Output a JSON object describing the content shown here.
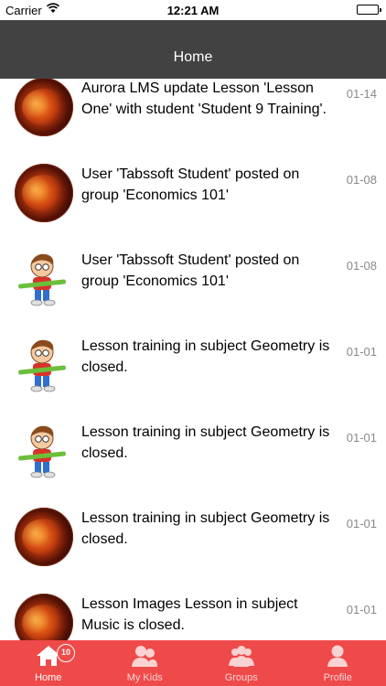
{
  "status_bar": {
    "carrier": "Carrier",
    "time": "12:21 AM"
  },
  "nav": {
    "title": "Home"
  },
  "feed": [
    {
      "avatar": "fire-avatar",
      "text": "Aurora LMS update Lesson 'Lesson One' with student 'Student 9 Training'.",
      "date": "01-14"
    },
    {
      "avatar": "fire-avatar",
      "text": "User 'Tabssoft Student' posted on group 'Economics 101'",
      "date": "01-08"
    },
    {
      "avatar": "kid-avatar",
      "text": "User 'Tabssoft Student' posted on group 'Economics 101'",
      "date": "01-08"
    },
    {
      "avatar": "kid-avatar",
      "text": "Lesson training in subject Geometry is closed.",
      "date": "01-01"
    },
    {
      "avatar": "kid-avatar",
      "text": "Lesson training in subject Geometry is closed.",
      "date": "01-01"
    },
    {
      "avatar": "fire-avatar",
      "text": "Lesson training in subject Geometry is closed.",
      "date": "01-01"
    },
    {
      "avatar": "fire-avatar",
      "text": "Lesson Images Lesson in subject Music is closed.",
      "date": "01-01"
    }
  ],
  "tabs": [
    {
      "label": "Home",
      "icon": "home-icon",
      "badge": "10",
      "active": true
    },
    {
      "label": "My Kids",
      "icon": "kids-icon",
      "active": false
    },
    {
      "label": "Groups",
      "icon": "groups-icon",
      "active": false
    },
    {
      "label": "Profile",
      "icon": "profile-icon",
      "active": false
    }
  ],
  "colors": {
    "nav_bg": "#424242",
    "tab_bg": "#ef4a4a",
    "date": "#8a8a8a"
  }
}
